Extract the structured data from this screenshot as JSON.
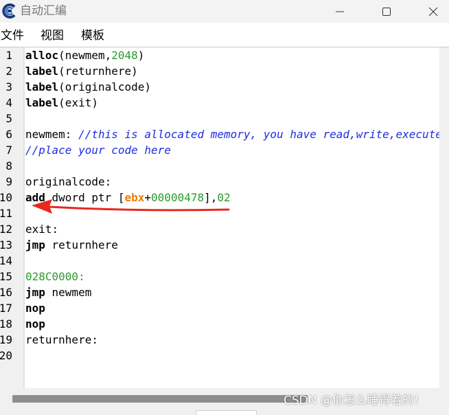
{
  "window": {
    "title": "自动汇编",
    "app_icon": "cheat-engine-icon",
    "controls": [
      "minimize-icon",
      "maximize-icon",
      "close-icon"
    ]
  },
  "menu": {
    "file": "文件",
    "view": "视图",
    "template": "模板"
  },
  "line_numbers": [
    "1",
    "2",
    "3",
    "4",
    "5",
    "6",
    "7",
    "8",
    "9",
    "10",
    "11",
    "12",
    "13",
    "14",
    "15",
    "16",
    "17",
    "18",
    "19",
    "20"
  ],
  "code_lines": [
    [
      {
        "t": "alloc",
        "c": "kw"
      },
      {
        "t": "(newmem,",
        "c": "op"
      },
      {
        "t": "2048",
        "c": "num"
      },
      {
        "t": ")",
        "c": "op"
      }
    ],
    [
      {
        "t": "label",
        "c": "kw"
      },
      {
        "t": "(returnhere)",
        "c": "op"
      }
    ],
    [
      {
        "t": "label",
        "c": "kw"
      },
      {
        "t": "(originalcode)",
        "c": "op"
      }
    ],
    [
      {
        "t": "label",
        "c": "kw"
      },
      {
        "t": "(exit)",
        "c": "op"
      }
    ],
    [],
    [
      {
        "t": "newmem: ",
        "c": "op"
      },
      {
        "t": "//this is allocated memory, you have read,write,execute access",
        "c": "comment"
      }
    ],
    [
      {
        "t": "//place your code here",
        "c": "comment"
      }
    ],
    [],
    [
      {
        "t": "originalcode:",
        "c": "op"
      }
    ],
    [
      {
        "t": "add",
        "c": "kw"
      },
      {
        "t": " dword ptr [",
        "c": "op"
      },
      {
        "t": "ebx",
        "c": "reg"
      },
      {
        "t": "+",
        "c": "op"
      },
      {
        "t": "00000478",
        "c": "num"
      },
      {
        "t": "],",
        "c": "op"
      },
      {
        "t": "02",
        "c": "num"
      }
    ],
    [],
    [
      {
        "t": "exit:",
        "c": "op"
      }
    ],
    [
      {
        "t": "jmp",
        "c": "kw"
      },
      {
        "t": " returnhere",
        "c": "op"
      }
    ],
    [],
    [
      {
        "t": "028C0000:",
        "c": "num"
      }
    ],
    [
      {
        "t": "jmp",
        "c": "kw"
      },
      {
        "t": " newmem",
        "c": "op"
      }
    ],
    [
      {
        "t": "nop",
        "c": "kw"
      }
    ],
    [
      {
        "t": "nop",
        "c": "kw"
      }
    ],
    [
      {
        "t": "returnhere:",
        "c": "op"
      }
    ],
    []
  ],
  "annotation": {
    "type": "arrow",
    "color": "#e8281e",
    "points_to_line": "10"
  },
  "watermark": "CSDN @你怎么睡得着的！",
  "colors": {
    "keyword": "#000000",
    "number": "#2a9a2a",
    "comment": "#1d2dde",
    "register": "#f07a00",
    "gutter_bg": "#f0f0f0",
    "titlebar_bg": "#f3f3f3"
  }
}
